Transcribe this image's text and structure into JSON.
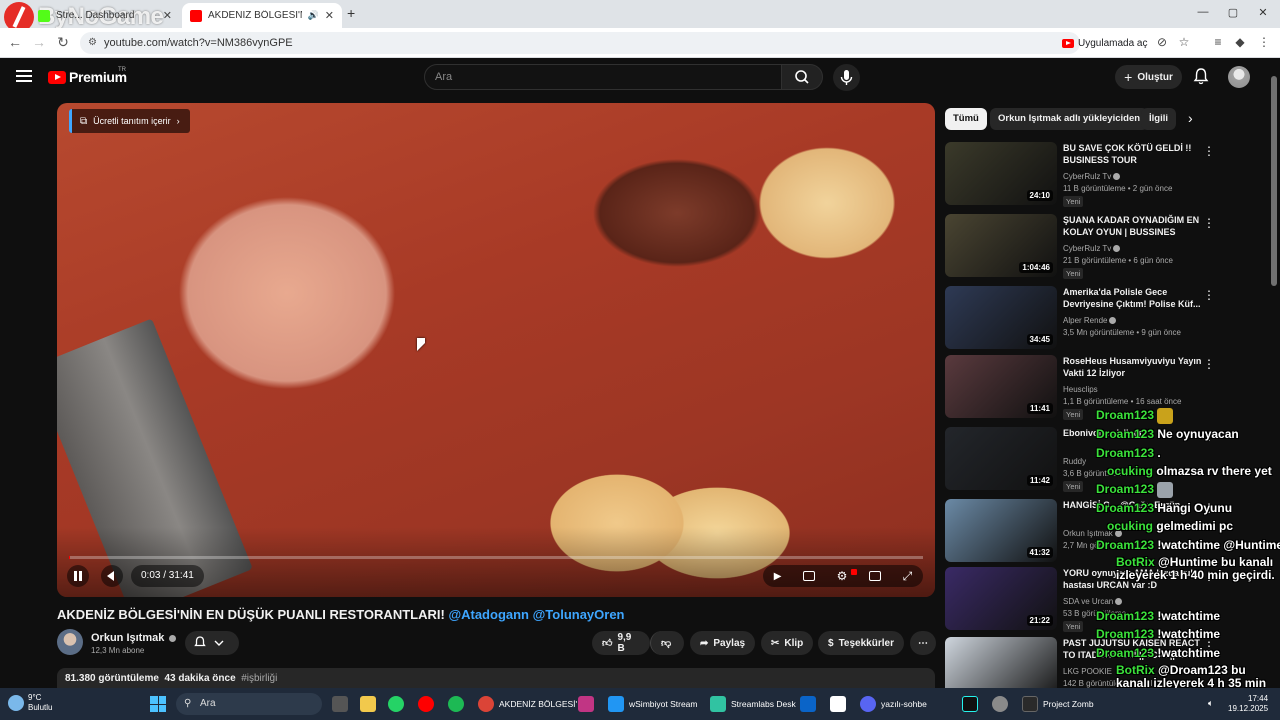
{
  "browser": {
    "tabs": [
      {
        "label": "Stre...  Dashboard",
        "active": false
      },
      {
        "label": "AKDENİZ BÖLGESİ'NİN EN D",
        "active": true
      }
    ],
    "new_tab_glyph": "+",
    "url": "youtube.com/watch?v=NM386vynGPE",
    "open_in_app_label": "Uygulamada aç",
    "window_controls": [
      "—",
      "▢",
      "✕"
    ]
  },
  "watermark": {
    "text": "ByNoGame"
  },
  "youtube_header": {
    "logo_text": "Premium",
    "logo_region": "TR",
    "search_placeholder": "Ara",
    "create_label": "Oluştur"
  },
  "player": {
    "promo_badge": "Ücretli tanıtım içerir",
    "time_display": "0:03 / 31:41",
    "progress": 0.0016
  },
  "video": {
    "title": "AKDENİZ BÖLGESİ'NİN EN DÜŞÜK PUANLI RESTORANTLARI!",
    "title_tags": "@Atadogann @TolunayOren",
    "channel_name": "Orkun Işıtmak",
    "subscribers": "12,3 Mn abone",
    "likes": "9,9 B",
    "share_label": "Paylaş",
    "clip_label": "Klip",
    "thanks_label": "Teşekkürler",
    "views": "81.380 görüntüleme",
    "published": "43 dakika önce",
    "hashtag": "#işbirliği"
  },
  "chips": [
    {
      "label": "Tümü",
      "active": true
    },
    {
      "label": "Orkun Işıtmak adlı yükleyiciden",
      "active": false
    },
    {
      "label": "İlgili",
      "active": false
    }
  ],
  "sidebar": [
    {
      "title": "BU SAVE ÇOK KÖTÜ GELDİ !! BUSINESS TOUR",
      "channel": "CyberRulz Tv",
      "verified": true,
      "meta": "11 B görüntüleme • 2 gün önce",
      "badge": "Yeni",
      "duration": "24:10",
      "thumb_color": "#3b3a2a"
    },
    {
      "title": "ŞUANA KADAR OYNADIĞIM EN KOLAY OYUN | BUSSINES TOUR",
      "channel": "CyberRulz Tv",
      "verified": true,
      "meta": "21 B görüntüleme • 6 gün önce",
      "badge": "Yeni",
      "duration": "1:04:46",
      "thumb_color": "#4a4532"
    },
    {
      "title": "Amerika'da Polisle Gece Devriyesine Çıktım! Polise Küf...",
      "channel": "Alper Rende",
      "verified": true,
      "meta": "3,5 Mn görüntüleme • 9 gün önce",
      "badge": "",
      "duration": "34:45",
      "thumb_color": "#2e3a55"
    },
    {
      "title": "RoseHeus Husamviyuviyu Yayın Vakti 12 İzliyor",
      "channel": "Heusclips",
      "verified": false,
      "meta": "1,1 B görüntüleme • 16 saat önce",
      "badge": "Yeni",
      "duration": "11:41",
      "thumb_color": "#5a3a3e"
    },
    {
      "title": "Ebonivon ... izliyor",
      "channel": "Ruddy",
      "verified": false,
      "meta": "3,6 B görüntüleme",
      "badge": "Yeni",
      "duration": "11:42",
      "thumb_color": "#23262b"
    },
    {
      "title": "HANGİSİ G... @Çağrı Ergün",
      "channel": "Orkun Işıtmak",
      "verified": true,
      "meta": "2,7 Mn görüntüleme",
      "badge": "",
      "duration": "41:32",
      "thumb_color": "#6b8aa6"
    },
    {
      "title": "YORU oynuyom AMA kızda ruh hastası URCAN var :D",
      "channel": "SDA ve Urcan",
      "verified": true,
      "meta": "53 B görüntüleme",
      "badge": "Yeni",
      "duration": "21:22",
      "thumb_color": "#3a2a66"
    },
    {
      "title": "PAST JUJUTSU KAISEN REACT TO ITADORI YUJI ||GCRV|| ILK...",
      "channel": "LKG POOKIE",
      "verified": false,
      "meta": "142 B görüntüleme • 1 yıl",
      "badge": "",
      "duration": "",
      "thumb_color": "#cfd6de"
    }
  ],
  "chat": [
    {
      "user": "Droam123",
      "message": "",
      "emote_color": "#c9a21b"
    },
    {
      "user": "Droam123",
      "message": "Ne oynuyacan",
      "emote_color": ""
    },
    {
      "user": "Droam123",
      "message": ".",
      "emote_color": ""
    },
    {
      "user": "ocuking",
      "message": "olmazsa rv there yet",
      "emote_color": ""
    },
    {
      "user": "Droam123",
      "message": "",
      "emote_color": "#9aa2aa"
    },
    {
      "user": "Droam123",
      "message": "Hangi Oyunu",
      "emote_color": ""
    },
    {
      "user": "ocuking",
      "message": "gelmedimi pc",
      "emote_color": ""
    },
    {
      "user": "Droam123",
      "message": "!watchtime @Huntime",
      "emote_color": ""
    },
    {
      "user": "BotRix",
      "message": "@Huntime bu kanalı izleyerek 1 h 40 min geçirdi.",
      "emote_color": ""
    },
    {
      "user": "Droam123",
      "message": "!watchtime",
      "emote_color": ""
    },
    {
      "user": "Droam123",
      "message": "!watchtime",
      "emote_color": ""
    },
    {
      "user": "Droam123",
      "message": "!watchtime",
      "emote_color": ""
    },
    {
      "user": "BotRix",
      "message": "@Droam123 bu kanalı izleyerek 4 h 35 min geçirdi.",
      "emote_color": ""
    }
  ],
  "taskbar": {
    "weather_temp": "9°C",
    "weather_desc": "Bulutlu",
    "search_placeholder": "Ara",
    "apps": [
      {
        "label": "AKDENİZ BÖLGESİ'",
        "color": "#db4437"
      },
      {
        "label": "wSimbiyot Stream",
        "color": "#2196f3"
      },
      {
        "label": "Streamlabs Desk",
        "color": "#31c3a2"
      },
      {
        "label": "yazılı-sohbe",
        "color": "#5865f2"
      },
      {
        "label": "Project Zomb",
        "color": "#2a2a2a"
      }
    ],
    "time": "17:44",
    "date": "19.12.2025"
  }
}
